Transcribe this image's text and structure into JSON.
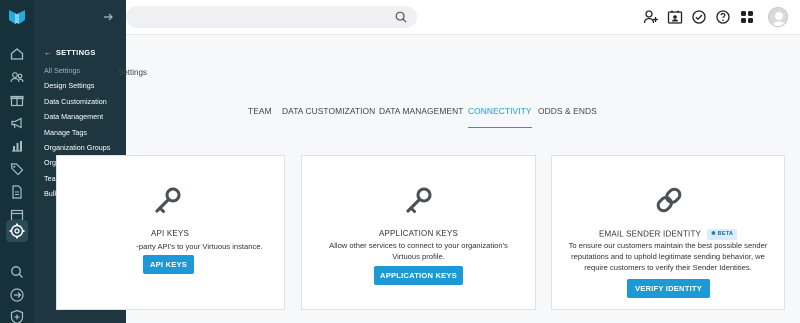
{
  "flyout": {
    "title": "SETTINGS",
    "items": [
      "All Settings",
      "Design Settings",
      "Data Customization",
      "Data Management",
      "Manage Tags",
      "Organization Groups",
      "Organization Settings",
      "Team Settings",
      "Bulk Data Tools"
    ]
  },
  "breadcrumb": "Settings",
  "tabs": [
    "TEAM",
    "DATA CUSTOMIZATION",
    "DATA MANAGEMENT",
    "CONNECTIVITY",
    "ODDS & ENDS"
  ],
  "active_tab": "CONNECTIVITY",
  "cards": [
    {
      "title": "API KEYS",
      "description": "-party API's to your Virtuous instance.",
      "button": "API KEYS"
    },
    {
      "title": "APPLICATION KEYS",
      "description_lines": [
        "Allow other services to connect to your organization's",
        "Virtuous profile."
      ],
      "button": "APPLICATION KEYS"
    },
    {
      "title": "EMAIL SENDER IDENTITY",
      "badge": "BETA",
      "description_lines": [
        "To ensure our customers maintain the best possible sender",
        "reputations and to uphold legitimate sending behavior, we",
        "require customers to verify their Sender Identities."
      ],
      "button": "VERIFY IDENTITY"
    }
  ],
  "icons": {
    "rail": [
      "home-icon",
      "people-icon",
      "gift-icon",
      "megaphone-icon",
      "chart-icon",
      "tag-icon",
      "document-icon",
      "calendar-icon",
      "settings-icon",
      "search-icon",
      "sign-out-icon",
      "plus-icon"
    ],
    "topbar": [
      "add-user-icon",
      "id-card-icon",
      "check-circle-icon",
      "help-icon",
      "apps-grid-icon"
    ]
  },
  "colors": {
    "accent": "#1d9ad6",
    "rail": "#17313a",
    "flyout": "#1d3640"
  }
}
